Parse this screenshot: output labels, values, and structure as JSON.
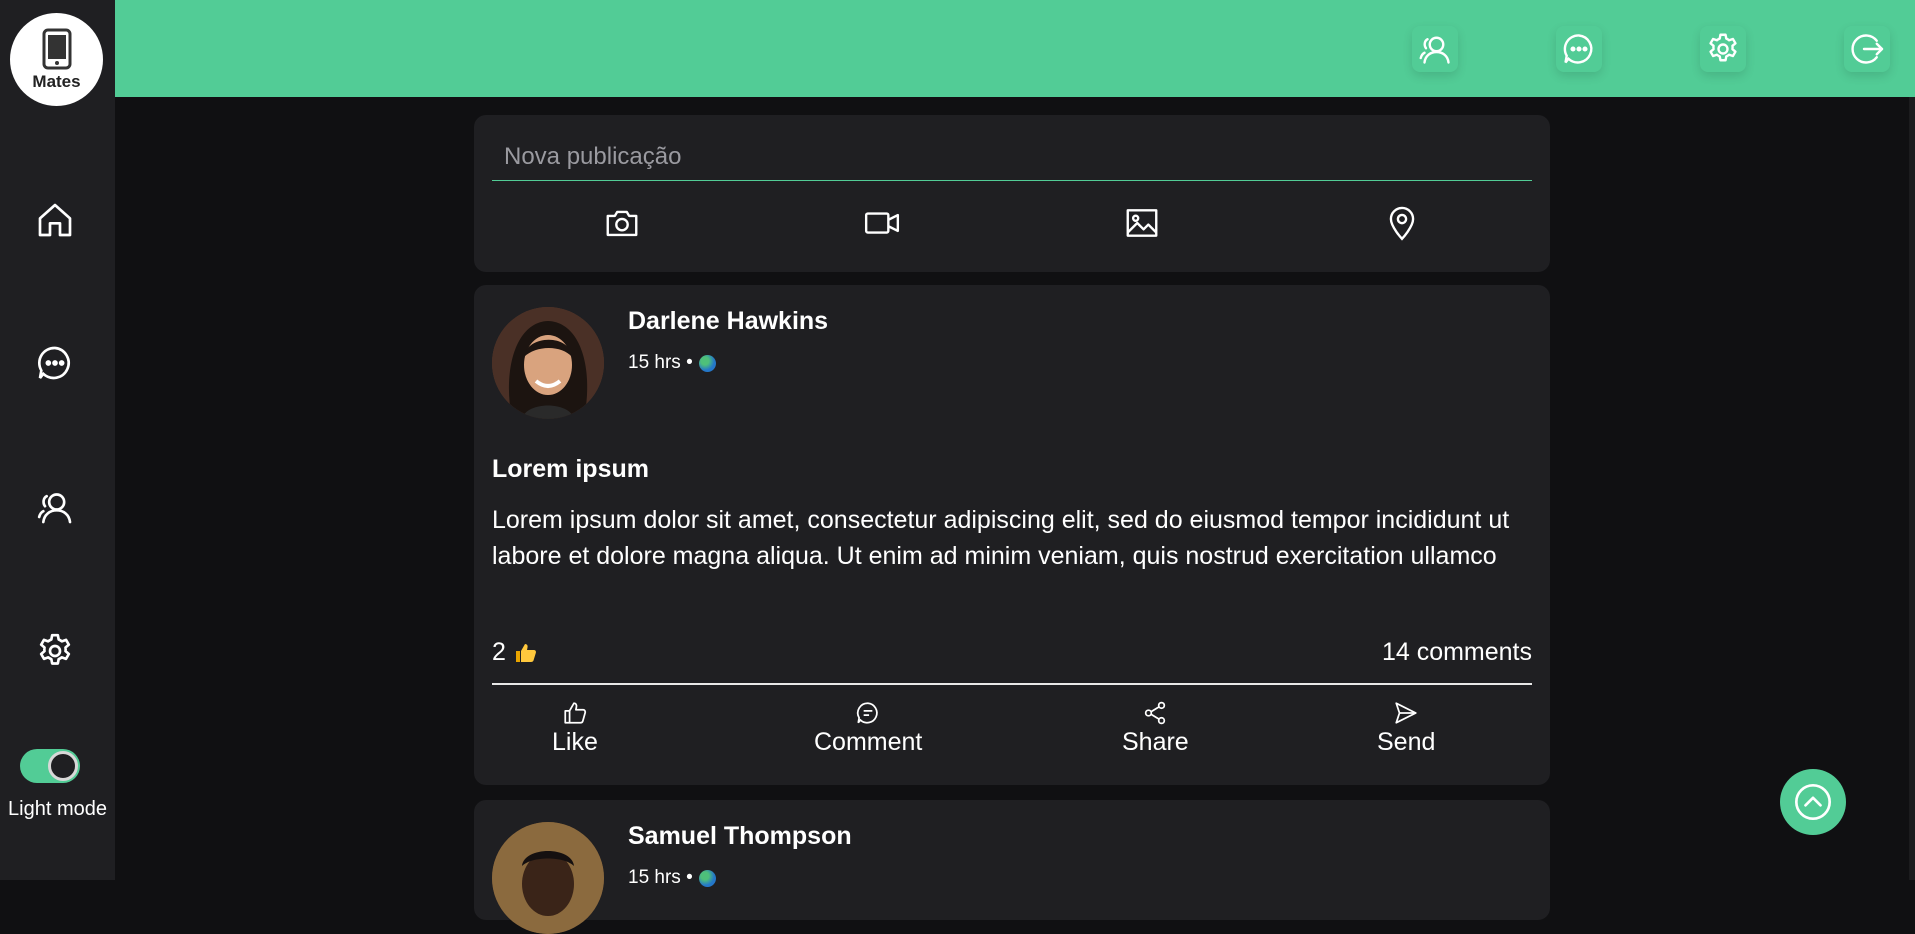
{
  "app": {
    "logo_text": "Mates"
  },
  "sidebar": {
    "items": [
      {
        "icon": "home-icon"
      },
      {
        "icon": "chat-icon"
      },
      {
        "icon": "friends-icon"
      },
      {
        "icon": "gear-icon"
      }
    ],
    "theme_toggle": {
      "label": "Light mode",
      "state": "on"
    }
  },
  "header": {
    "icons": [
      "friends-icon",
      "chat-icon",
      "gear-icon",
      "logout-icon"
    ]
  },
  "composer": {
    "placeholder": "Nova publicação",
    "actions": [
      "camera-icon",
      "video-icon",
      "image-icon",
      "location-icon"
    ]
  },
  "posts": [
    {
      "author": "Darlene Hawkins",
      "time": "15 hrs •",
      "title": "Lorem ipsum",
      "body": "Lorem ipsum dolor sit amet, consectetur adipiscing elit, sed do eiusmod tempor incididunt ut labore et dolore magna aliqua. Ut enim ad minim veniam, quis nostrud exercitation ullamco",
      "likes": "2",
      "comments": "14 comments",
      "actions": [
        "Like",
        "Comment",
        "Share",
        "Send"
      ]
    },
    {
      "author": "Samuel Thompson",
      "time": "15 hrs •"
    }
  ],
  "colors": {
    "accent": "#52cc96",
    "card": "#1f1f22",
    "background": "#101012"
  }
}
